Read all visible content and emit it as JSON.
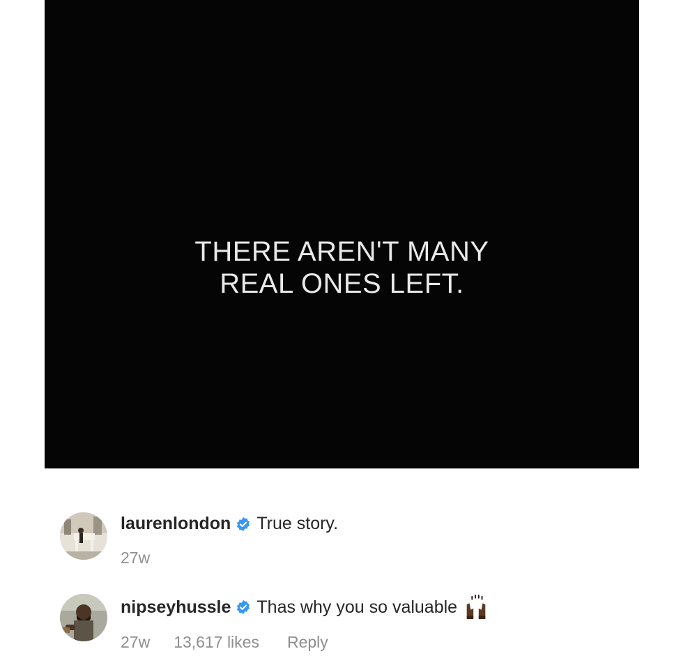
{
  "post": {
    "caption_lines": [
      "THERE AREN'T MANY",
      "REAL ONES LEFT."
    ],
    "background": "#050505"
  },
  "comments": [
    {
      "username": "laurenlondon",
      "verified": true,
      "text": "True story.",
      "time": "27w",
      "avatar_icon": "avatar-photo"
    },
    {
      "username": "nipseyhussle",
      "verified": true,
      "text": "Thas why you so valuable",
      "emoji": "raising-hands-emoji",
      "time": "27w",
      "likes": "13,617 likes",
      "reply_label": "Reply",
      "avatar_icon": "avatar-photo"
    }
  ],
  "colors": {
    "verified_badge": "#3897f0",
    "meta_text": "#8e8e8e",
    "primary_text": "#262626"
  }
}
